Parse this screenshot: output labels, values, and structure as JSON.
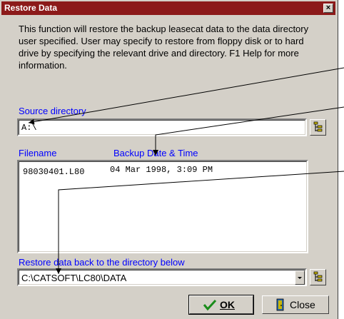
{
  "window": {
    "title": "Restore Data",
    "close_glyph": "×"
  },
  "description": "This function will restore the backup leasecat data to the data directory user specified. User may specify to restore from floppy disk or to hard drive by specifying the relevant drive and directory. F1 Help for more information.",
  "source": {
    "label": "Source directory",
    "value": "A:\\"
  },
  "files": {
    "filename_header": "Filename",
    "date_header": "Backup Date & Time",
    "rows": [
      {
        "filename": "98030401.L80",
        "datetime": "04 Mar 1998, 3:09 PM"
      }
    ]
  },
  "restore": {
    "label": "Restore data back to the directory below",
    "value": "C:\\CATSOFT\\LC80\\DATA"
  },
  "buttons": {
    "ok": "OK",
    "close": "Close"
  },
  "colors": {
    "title_bar": "#8c1a1a",
    "label_blue": "#0000ff",
    "dialog_face": "#d4d0c8",
    "ok_check": "#1a8c1a"
  },
  "icons": [
    "close-icon",
    "folder-tree-icon",
    "dropdown-arrow-icon",
    "checkmark-icon",
    "door-icon"
  ]
}
